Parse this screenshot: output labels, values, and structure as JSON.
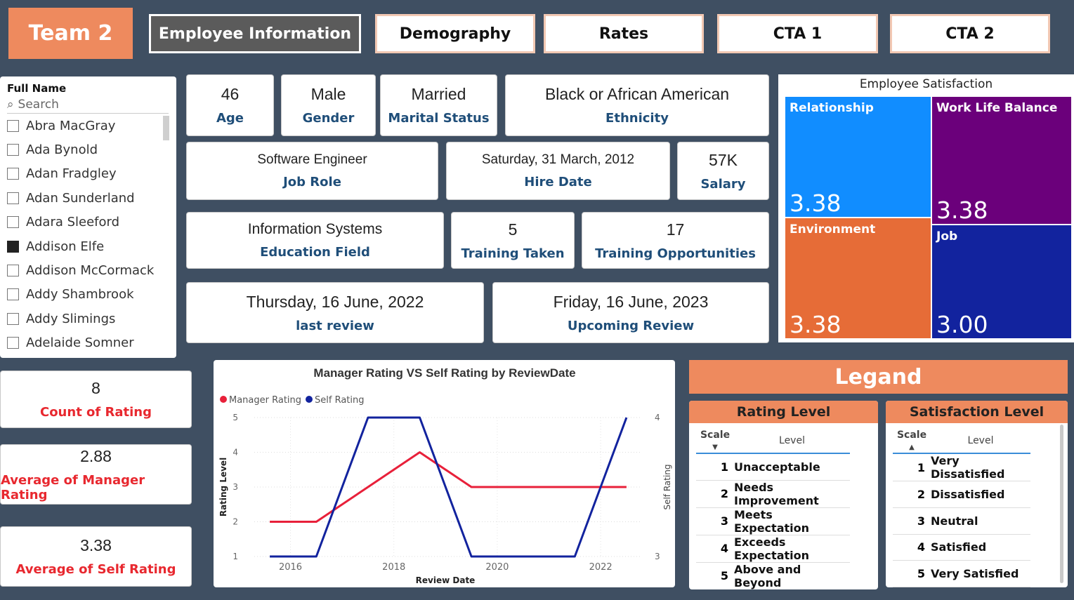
{
  "nav": {
    "team": "Team 2",
    "tabs": [
      "Employee Information",
      "Demography",
      "Rates",
      "CTA 1",
      "CTA 2"
    ]
  },
  "slicer": {
    "header": "Full Name",
    "search_placeholder": "Search",
    "items": [
      {
        "name": "Abra MacGray",
        "checked": false
      },
      {
        "name": "Ada Bynold",
        "checked": false
      },
      {
        "name": "Adan Fradgley",
        "checked": false
      },
      {
        "name": "Adan Sunderland",
        "checked": false
      },
      {
        "name": "Adara Sleeford",
        "checked": false
      },
      {
        "name": "Addison Elfe",
        "checked": true
      },
      {
        "name": "Addison McCormack",
        "checked": false
      },
      {
        "name": "Addy Shambrook",
        "checked": false
      },
      {
        "name": "Addy Slimings",
        "checked": false
      },
      {
        "name": "Adelaide Somner",
        "checked": false
      }
    ]
  },
  "cards": {
    "age": {
      "value": "46",
      "label": "Age"
    },
    "gender": {
      "value": "Male",
      "label": "Gender"
    },
    "marital": {
      "value": "Married",
      "label": "Marital Status"
    },
    "ethnicity": {
      "value": "Black or African American",
      "label": "Ethnicity"
    },
    "job_role": {
      "value": "Software Engineer",
      "label": "Job Role"
    },
    "hire_date": {
      "value": "Saturday, 31 March, 2012",
      "label": "Hire Date"
    },
    "salary": {
      "value": "57K",
      "label": "Salary"
    },
    "education": {
      "value": "Information Systems",
      "label": "Education Field"
    },
    "training_taken": {
      "value": "5",
      "label": "Training Taken"
    },
    "training_opps": {
      "value": "17",
      "label": "Training Opportunities"
    },
    "last_review": {
      "value": "Thursday, 16 June, 2022",
      "label": "last review"
    },
    "upcoming_review": {
      "value": "Friday, 16 June, 2023",
      "label": "Upcoming Review"
    }
  },
  "kpis": {
    "count": {
      "value": "8",
      "label": "Count of Rating"
    },
    "avg_manager": {
      "value": "2.88",
      "label": "Average of Manager Rating"
    },
    "avg_self": {
      "value": "3.38",
      "label": "Average of Self Rating"
    }
  },
  "satisfaction": {
    "title": "Employee Satisfaction",
    "tiles": [
      {
        "label": "Relationship",
        "value": "3.38",
        "color": "#118dff"
      },
      {
        "label": "Work Life Balance",
        "value": "3.38",
        "color": "#6b007b"
      },
      {
        "label": "Environment",
        "value": "3.38",
        "color": "#e66c37"
      },
      {
        "label": "Job",
        "value": "3.00",
        "color": "#12239e"
      }
    ]
  },
  "chart_data": {
    "type": "line",
    "title": "Manager Rating VS Self Rating by ReviewDate",
    "xlabel": "Review Date",
    "ylabel": "Rating Level",
    "y2label": "Self Rating",
    "x": [
      2015.6,
      2016.5,
      2017.5,
      2018.5,
      2019.5,
      2020.5,
      2021.5,
      2022.5
    ],
    "x_ticks": [
      "2016",
      "2018",
      "2020",
      "2022"
    ],
    "y_ticks": [
      "1",
      "2",
      "3",
      "4",
      "5"
    ],
    "y2_ticks": [
      "3",
      "4"
    ],
    "ylim": [
      1,
      5
    ],
    "y2lim": [
      3,
      4
    ],
    "series": [
      {
        "name": "Manager Rating",
        "color": "#e8203a",
        "axis": "left",
        "values": [
          2,
          2,
          3,
          4,
          3,
          3,
          3,
          3
        ]
      },
      {
        "name": "Self Rating",
        "color": "#12239e",
        "axis": "right",
        "values": [
          3,
          3,
          4,
          4,
          3,
          3,
          3,
          4
        ]
      }
    ],
    "legend_position": "top-left"
  },
  "legand": {
    "title": "Legand",
    "rating": {
      "title": "Rating Level",
      "col_scale": "Scale",
      "col_level": "Level",
      "rows": [
        {
          "scale": "1",
          "level": "Unacceptable"
        },
        {
          "scale": "2",
          "level": "Needs Improvement"
        },
        {
          "scale": "3",
          "level": "Meets Expectation"
        },
        {
          "scale": "4",
          "level": "Exceeds Expectation"
        },
        {
          "scale": "5",
          "level": "Above and Beyond"
        }
      ]
    },
    "satisfaction": {
      "title": "Satisfaction Level",
      "col_scale": "Scale",
      "col_level": "Level",
      "rows": [
        {
          "scale": "1",
          "level": "Very Dissatisfied"
        },
        {
          "scale": "2",
          "level": "Dissatisfied"
        },
        {
          "scale": "3",
          "level": "Neutral"
        },
        {
          "scale": "4",
          "level": "Satisfied"
        },
        {
          "scale": "5",
          "level": "Very Satisfied"
        }
      ]
    }
  }
}
